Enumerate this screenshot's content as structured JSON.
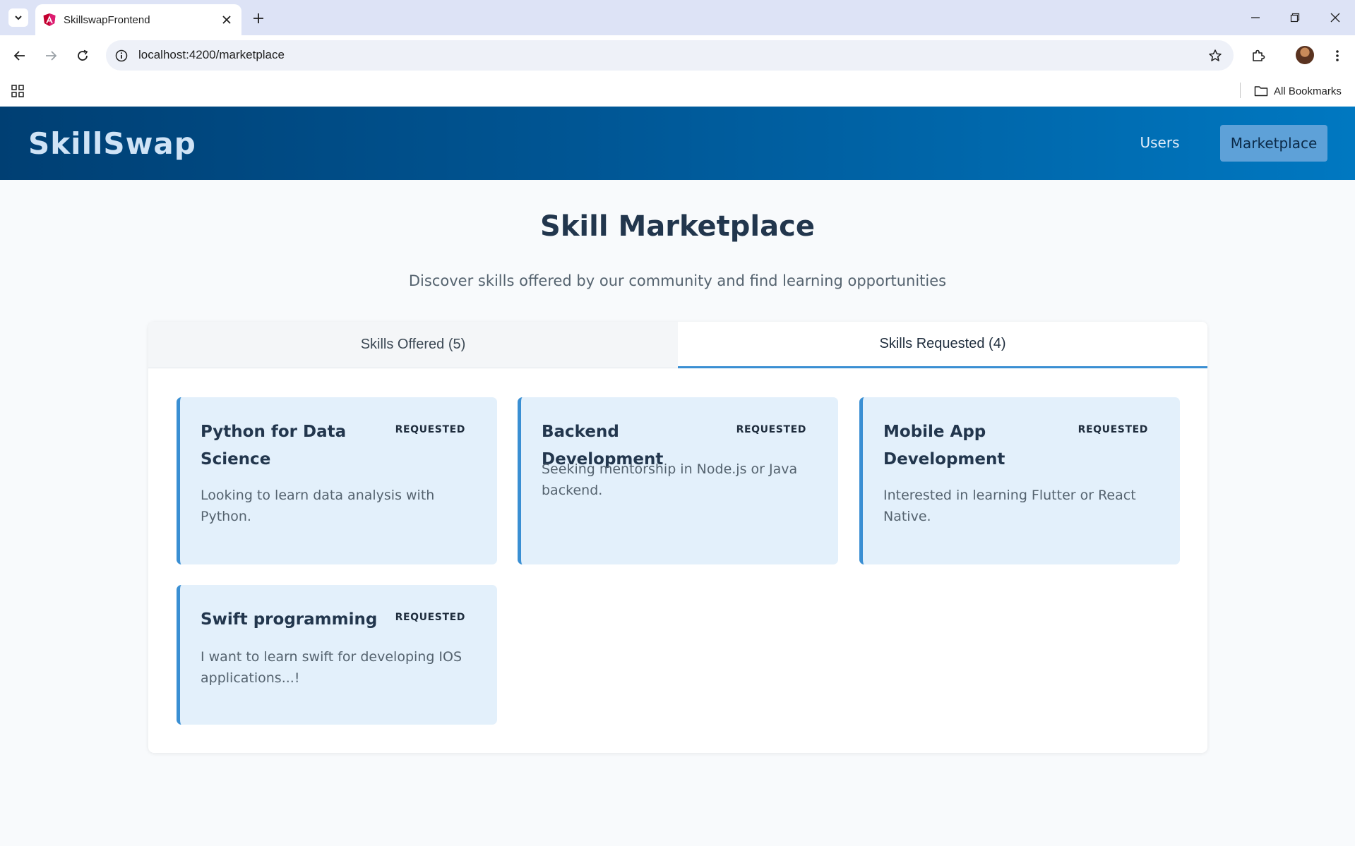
{
  "browser": {
    "tab_title": "SkillswapFrontend",
    "url": "localhost:4200/marketplace",
    "bookmarks_label": "All Bookmarks"
  },
  "header": {
    "logo": "SkillSwap",
    "nav": [
      {
        "label": "Users",
        "active": false
      },
      {
        "label": "Marketplace",
        "active": true
      }
    ]
  },
  "main": {
    "title": "Skill Marketplace",
    "subtitle": "Discover skills offered by our community and find learning opportunities",
    "tabs": [
      {
        "label": "Skills Offered (5)",
        "active": false
      },
      {
        "label": "Skills Requested (4)",
        "active": true
      }
    ],
    "cards": [
      {
        "title": "Python for Data Science",
        "badge": "REQUESTED",
        "description": "Looking to learn data analysis with Python."
      },
      {
        "title": "Backend Development",
        "badge": "REQUESTED",
        "description": "Seeking mentorship in Node.js or Java backend."
      },
      {
        "title": "Mobile App Development",
        "badge": "REQUESTED",
        "description": "Interested in learning Flutter or React Native."
      },
      {
        "title": "Swift programming",
        "badge": "REQUESTED",
        "description": "I want to learn swift for developing IOS applications...!"
      }
    ]
  },
  "colors": {
    "header_gradient_start": "#003f73",
    "header_gradient_end": "#0078c1",
    "accent": "#3a8fd3",
    "card_background": "#e3f0fb",
    "active_nav_button": "#5ea1d8"
  }
}
